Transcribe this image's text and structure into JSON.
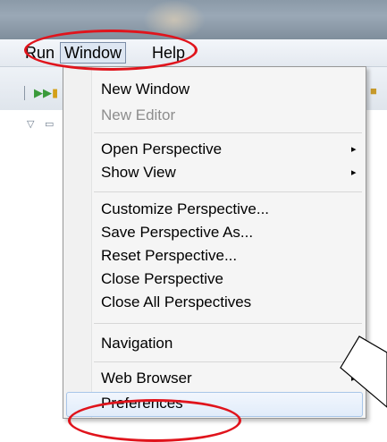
{
  "menubar": {
    "items": [
      "Run",
      "Window",
      "Help"
    ]
  },
  "toolbar": {
    "icons": [
      "separator",
      "run-icon",
      "yellow-icon",
      "folder-icon",
      "triangle-icon",
      "minimize-icon"
    ]
  },
  "window_menu": {
    "items": [
      {
        "label": "New Window",
        "enabled": true,
        "submenu": false
      },
      {
        "label": "New Editor",
        "enabled": false,
        "submenu": false
      },
      {
        "label": "Open Perspective",
        "enabled": true,
        "submenu": true
      },
      {
        "label": "Show View",
        "enabled": true,
        "submenu": true
      },
      {
        "label": "Customize Perspective...",
        "enabled": true,
        "submenu": false
      },
      {
        "label": "Save Perspective As...",
        "enabled": true,
        "submenu": false
      },
      {
        "label": "Reset Perspective...",
        "enabled": true,
        "submenu": false
      },
      {
        "label": "Close Perspective",
        "enabled": true,
        "submenu": false
      },
      {
        "label": "Close All Perspectives",
        "enabled": true,
        "submenu": false
      },
      {
        "label": "Navigation",
        "enabled": true,
        "submenu": false
      },
      {
        "label": "Web Browser",
        "enabled": true,
        "submenu": true
      },
      {
        "label": "Preferences",
        "enabled": true,
        "submenu": false,
        "highlighted": true
      }
    ]
  },
  "annotations": {
    "highlight_color": "#e0141c",
    "circled": [
      "Window",
      "Preferences"
    ]
  }
}
